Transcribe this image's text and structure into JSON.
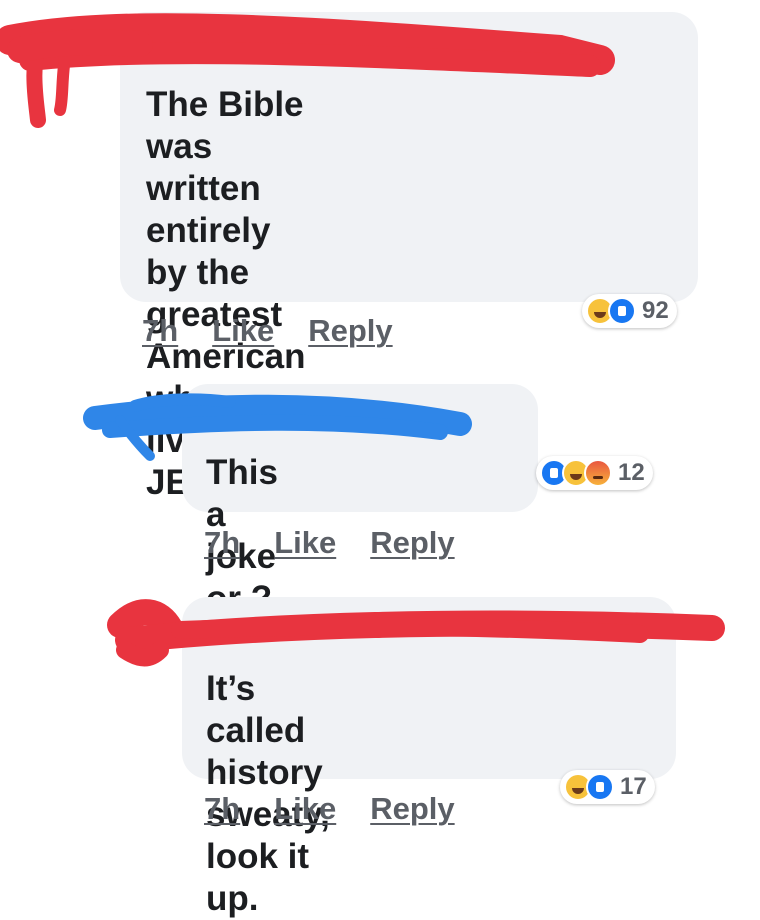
{
  "comments": [
    {
      "text": "The Bible was written\nentirely by the greatest\nAmerican who ever lived:\nJESUS",
      "time": "7h",
      "like": "Like",
      "reply": "Reply",
      "reactions": [
        "haha-icon",
        "like-icon"
      ],
      "reaction_count": "92"
    },
    {
      "text": "This a joke or ?",
      "time": "7h",
      "like": "Like",
      "reply": "Reply",
      "reactions": [
        "like-icon",
        "haha-icon",
        "angry-icon"
      ],
      "reaction_count": "12"
    },
    {
      "text": "It’s called history\nsweaty, look it up.",
      "time": "7h",
      "like": "Like",
      "reply": "Reply",
      "reactions": [
        "haha-icon",
        "like-icon"
      ],
      "reaction_count": "17"
    }
  ],
  "colors": {
    "bubble": "#f0f2f5",
    "redaction_red": "#e8343f",
    "redaction_blue": "#2f86e8",
    "like_blue": "#1877f2",
    "haha_yellow": "#f7c23b"
  }
}
